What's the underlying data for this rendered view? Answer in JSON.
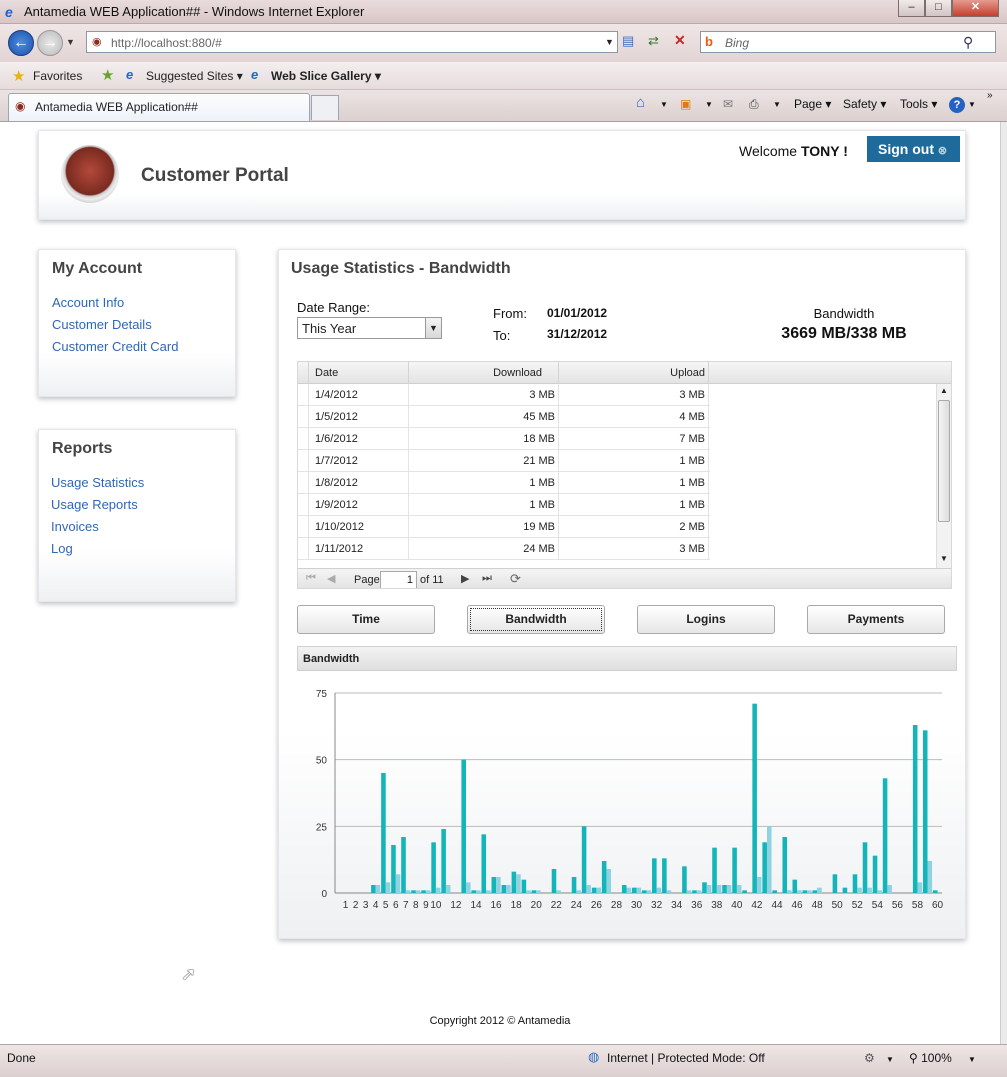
{
  "browser": {
    "window_title": "Antamedia WEB Application## - Windows Internet Explorer",
    "url": "http://localhost:880/#",
    "search_placeholder": "Bing",
    "favorites_label": "Favorites",
    "suggested_sites": "Suggested Sites",
    "web_slice_gallery": "Web Slice Gallery",
    "tab_title": "Antamedia WEB Application##",
    "cmd_page": "Page",
    "cmd_safety": "Safety",
    "cmd_tools": "Tools",
    "status_left": "Done",
    "status_zone": "Internet | Protected Mode: Off",
    "zoom": "100%"
  },
  "header": {
    "title": "Customer Portal",
    "welcome_prefix": "Welcome",
    "username": "TONY !",
    "signout_label": "Sign out"
  },
  "my_account": {
    "title": "My Account",
    "links": [
      "Account Info",
      "Customer Details",
      "Customer Credit Card"
    ]
  },
  "reports": {
    "title": "Reports",
    "links": [
      "Usage Statistics",
      "Usage Reports",
      "Invoices",
      "Log"
    ]
  },
  "main": {
    "title": "Usage Statistics - Bandwidth",
    "date_range_label": "Date Range:",
    "date_range_value": "This Year",
    "from_label": "From:",
    "from_value": "01/01/2012",
    "to_label": "To:",
    "to_value": "31/12/2012",
    "bandwidth_label": "Bandwidth",
    "bandwidth_value": "3669 MB/338 MB"
  },
  "grid": {
    "columns": [
      "Date",
      "Download",
      "Upload"
    ],
    "rows": [
      [
        "1/4/2012",
        "3 MB",
        "3 MB"
      ],
      [
        "1/5/2012",
        "45 MB",
        "4 MB"
      ],
      [
        "1/6/2012",
        "18 MB",
        "7 MB"
      ],
      [
        "1/7/2012",
        "21 MB",
        "1 MB"
      ],
      [
        "1/8/2012",
        "1 MB",
        "1 MB"
      ],
      [
        "1/9/2012",
        "1 MB",
        "1 MB"
      ],
      [
        "1/10/2012",
        "19 MB",
        "2 MB"
      ],
      [
        "1/11/2012",
        "24 MB",
        "3 MB"
      ]
    ],
    "pager_page_label": "Page",
    "pager_page_value": "1",
    "pager_of": "of 11"
  },
  "tabs": [
    "Time",
    "Bandwidth",
    "Logins",
    "Payments"
  ],
  "chart_header": "Bandwidth",
  "chart_data": {
    "type": "bar",
    "title": "",
    "xlabel": "",
    "ylabel": "",
    "ylim": [
      0,
      75
    ],
    "yticks": [
      0,
      25,
      50,
      75
    ],
    "grid": true,
    "categories": [
      1,
      2,
      3,
      4,
      5,
      6,
      7,
      8,
      9,
      10,
      11,
      12,
      13,
      14,
      15,
      16,
      17,
      18,
      19,
      20,
      21,
      22,
      23,
      24,
      25,
      26,
      27,
      28,
      29,
      30,
      31,
      32,
      33,
      34,
      35,
      36,
      37,
      38,
      39,
      40,
      41,
      42,
      43,
      44,
      45,
      46,
      47,
      48,
      49,
      50,
      51,
      52,
      53,
      54,
      55,
      56,
      57,
      58,
      59,
      60
    ],
    "xtick_labels": [
      "1",
      "2",
      "3",
      "4",
      "5",
      "6",
      "7",
      "8",
      "9",
      "10",
      "12",
      "14",
      "16",
      "18",
      "20",
      "22",
      "24",
      "26",
      "28",
      "30",
      "32",
      "34",
      "36",
      "38",
      "40",
      "42",
      "44",
      "46",
      "48",
      "50",
      "52",
      "54",
      "56",
      "58",
      "60"
    ],
    "series": [
      {
        "color": "#13b5b8",
        "values": [
          0,
          0,
          0,
          3,
          45,
          18,
          21,
          1,
          1,
          19,
          24,
          0,
          50,
          1,
          22,
          6,
          3,
          8,
          5,
          1,
          0,
          9,
          0,
          6,
          25,
          2,
          12,
          0,
          3,
          2,
          1,
          13,
          13,
          0,
          10,
          1,
          4,
          17,
          3,
          17,
          1,
          71,
          19,
          1,
          21,
          5,
          1,
          1,
          0,
          7,
          2,
          7,
          19,
          14,
          43,
          0,
          0,
          63,
          61,
          1
        ]
      },
      {
        "color": "#8fd2e0",
        "values": [
          0,
          0,
          0,
          3,
          4,
          7,
          1,
          1,
          1,
          2,
          3,
          0,
          4,
          1,
          1,
          6,
          3,
          7,
          1,
          1,
          0,
          1,
          0,
          1,
          3,
          2,
          9,
          0,
          2,
          2,
          1,
          2,
          1,
          0,
          1,
          1,
          3,
          3,
          3,
          3,
          0,
          6,
          25,
          0,
          1,
          1,
          1,
          2,
          0,
          0,
          0,
          2,
          2,
          1,
          3,
          0,
          0,
          4,
          12,
          0
        ]
      }
    ]
  },
  "footer": "Copyright 2012 © Antamedia"
}
